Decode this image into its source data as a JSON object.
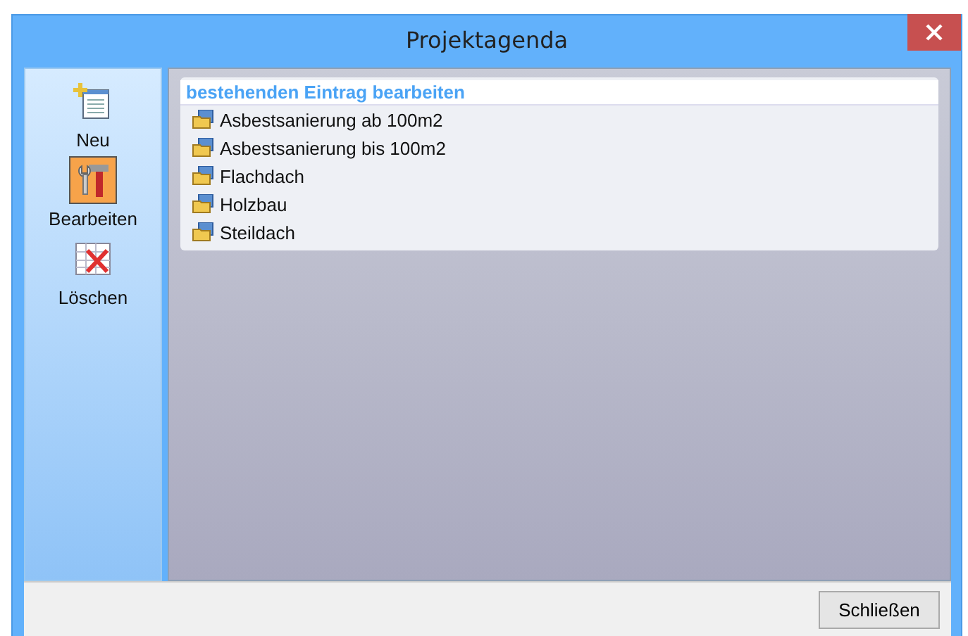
{
  "window": {
    "title": "Projektagenda"
  },
  "sidebar": {
    "items": [
      {
        "label": "Neu",
        "kind": "new",
        "selected": false
      },
      {
        "label": "Bearbeiten",
        "kind": "edit",
        "selected": true
      },
      {
        "label": "Löschen",
        "kind": "delete",
        "selected": false
      }
    ]
  },
  "list": {
    "heading": "bestehenden Eintrag bearbeiten",
    "items": [
      "Asbestsanierung ab 100m2",
      "Asbestsanierung bis 100m2",
      "Flachdach",
      "Holzbau",
      "Steildach"
    ]
  },
  "buttons": [
    "Schließen"
  ]
}
